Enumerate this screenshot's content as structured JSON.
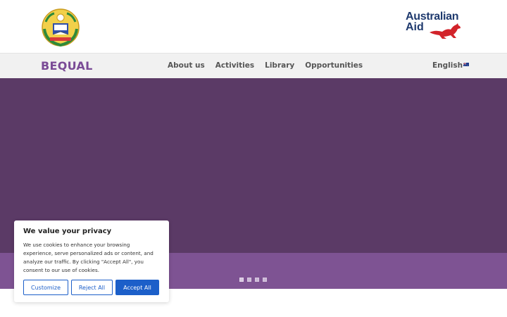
{
  "header": {
    "seal_name": "government-seal",
    "partner_logo": {
      "line1": "Australian",
      "line2": "Aid",
      "color": "#1f3a6e",
      "kangaroo_color": "#d2232a"
    }
  },
  "nav": {
    "brand": "BEQUAL",
    "brand_color": "#7a4b96",
    "items": [
      {
        "label": "About us"
      },
      {
        "label": "Activities"
      },
      {
        "label": "Library"
      },
      {
        "label": "Opportunities"
      }
    ],
    "language": "English",
    "language_flag": "australia-flag-icon"
  },
  "hero": {
    "background": "#5b3a66",
    "band_color": "#7e5393",
    "slides_count": 4,
    "active_slide": 1
  },
  "cookie": {
    "title": "We value your privacy",
    "body": "We use cookies to enhance your browsing experience, serve personalized ads or content, and analyze our traffic. By clicking \"Accept All\", you consent to our use of cookies.",
    "customize_label": "Customize",
    "reject_label": "Reject All",
    "accept_label": "Accept All",
    "accent": "#1c5fc9"
  }
}
